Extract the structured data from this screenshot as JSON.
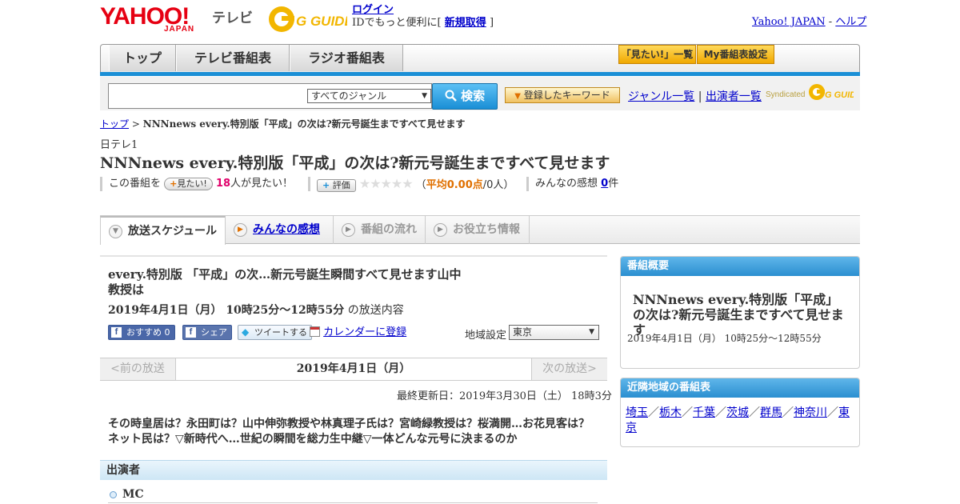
{
  "header": {
    "brand": "YAHOO!",
    "brand_sub": "JAPAN",
    "brand_tv": "テレビ",
    "gguide": "G GUIDE",
    "login": "ログイン",
    "login_sub_prefix": "IDでもっと便利に[",
    "register": "新規取得",
    "login_sub_suffix": "]",
    "yahoo_japan": "Yahoo! JAPAN",
    "sep": "-",
    "help": "ヘルプ"
  },
  "nav": {
    "tabs": [
      "トップ",
      "テレビ番組表",
      "ラジオ番組表"
    ],
    "mitai_list": "「見たい!」一覧",
    "my_settings": "My番組表設定"
  },
  "search": {
    "genre": "すべてのジャンル",
    "button": "検索",
    "keyword_button": "登録したキーワード",
    "genre_list": "ジャンル一覧",
    "divider": "|",
    "performer_list": "出演者一覧",
    "syndicated": "Syndicated",
    "gguide_small": "G GUIDE"
  },
  "breadcrumb": {
    "top": "トップ",
    "separator": ">",
    "current": "NNNnews every.特別版「平成」の次は?新元号誕生まですべて見せます"
  },
  "program": {
    "channel": "日テレ1",
    "title": "NNNnews every.特別版「平成」の次は?新元号誕生まですべて見せます",
    "mitai_prefix": "この番組を",
    "mitai_button": "見たい!",
    "mitai_count": "18",
    "mitai_suffix": "人が見たい！",
    "rate_button": "評価",
    "rating_open": "（",
    "rating_label": "平均0.00点",
    "rating_people": "/0人）",
    "rating_stars": 0,
    "impressions_label": "みんなの感想",
    "impressions_count": "0",
    "impressions_suffix": "件"
  },
  "tabs": [
    {
      "label": "放送スケジュール",
      "state": "active"
    },
    {
      "label": "みんなの感想",
      "state": "link"
    },
    {
      "label": "番組の流れ",
      "state": "disabled"
    },
    {
      "label": "お役立ち情報",
      "state": "disabled"
    }
  ],
  "episode": {
    "title": "every.特別版 「平成」の次…新元号誕生瞬間すべて見せます山中教授は",
    "date": "2019年4月1日（月） 10時25分～12時55分",
    "date_suffix": "の放送内容",
    "fb_recommend": "おすすめ 0",
    "fb_share": "シェア",
    "tweet": "ツイートする",
    "calendar": "カレンダーに登録",
    "region_label": "地域設定",
    "region_value": "東京",
    "prev": "<前の放送",
    "current_day": "2019年4月1日（月）",
    "next": "次の放送>",
    "updated": "最終更新日：2019年3月30日（土） 18時3分",
    "description": "その時皇居は？永田町は？山中伸弥教授や林真理子氏は？宮崎緑教授は？桜満開…お花見客は？ネット民は？▽新時代へ…世紀の瞬間を総力生中継▽一体どんな元号に決まるのか",
    "cast_heading": "出演者",
    "cast_first": "MC"
  },
  "sidebar": {
    "summary_heading": "番組概要",
    "summary_title": "NNNnews every.特別版「平成」の次は?新元号誕生まですべて見せます",
    "summary_date": "2019年4月1日（月） 10時25分～12時55分",
    "nearby_heading": "近隣地域の番組表",
    "nearby": [
      "埼玉",
      "栃木",
      "千葉",
      "茨城",
      "群馬",
      "神奈川",
      "東京"
    ],
    "nearby_sep": "／"
  },
  "colors": {
    "accent_blue": "#1a8fd6",
    "brand_red": "#e60012",
    "pink": "#e0006a",
    "orange": "#e07000"
  }
}
